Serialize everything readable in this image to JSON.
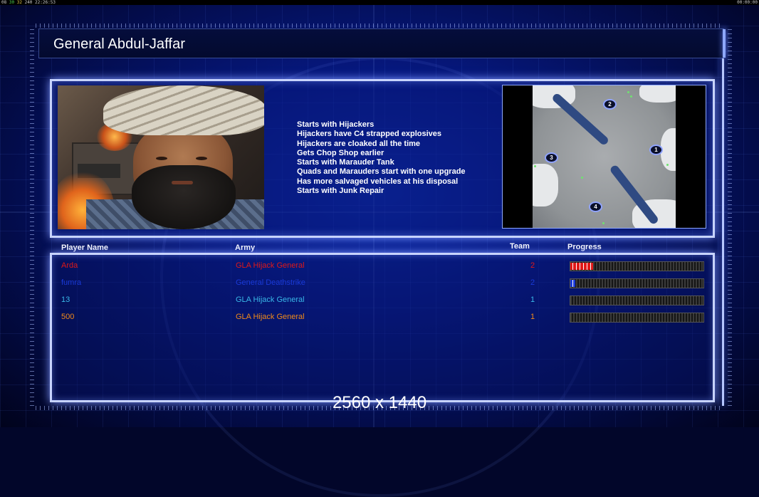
{
  "status": {
    "left_clock": {
      "a": "08",
      "b": "30",
      "c": "32",
      "d": "240",
      "time": "22:26:53"
    },
    "right_clock": "00:00:00"
  },
  "general": {
    "name": "General Abdul-Jaffar",
    "traits": [
      "Starts with Hijackers",
      "Hijackers have C4 strapped explosives",
      "Hijackers are cloaked all the time",
      "Gets Chop Shop earlier",
      "Starts with Marauder Tank",
      "Quads and Marauders start with one upgrade",
      "Has more salvaged vehicles at his disposal",
      "Starts with Junk Repair"
    ]
  },
  "map": {
    "spawns": [
      "1",
      "2",
      "3",
      "4"
    ]
  },
  "table": {
    "headers": {
      "player": "Player Name",
      "army": "Army",
      "team": "Team",
      "progress": "Progress"
    },
    "rows": [
      {
        "player": "Arda",
        "army": "GLA Hijack General",
        "team": "2",
        "color": "#e01818",
        "progress": 0.17
      },
      {
        "player": "fumra",
        "army": "General Deathstrike",
        "team": "2",
        "color": "#1a3ad8",
        "progress": 0.04
      },
      {
        "player": "13",
        "army": "GLA Hijack General",
        "team": "1",
        "color": "#39b7e8",
        "progress": 0
      },
      {
        "player": "500",
        "army": "GLA Hijack General",
        "team": "1",
        "color": "#f08a1a",
        "progress": 0
      }
    ]
  },
  "resolution_label": "2560 x 1440"
}
